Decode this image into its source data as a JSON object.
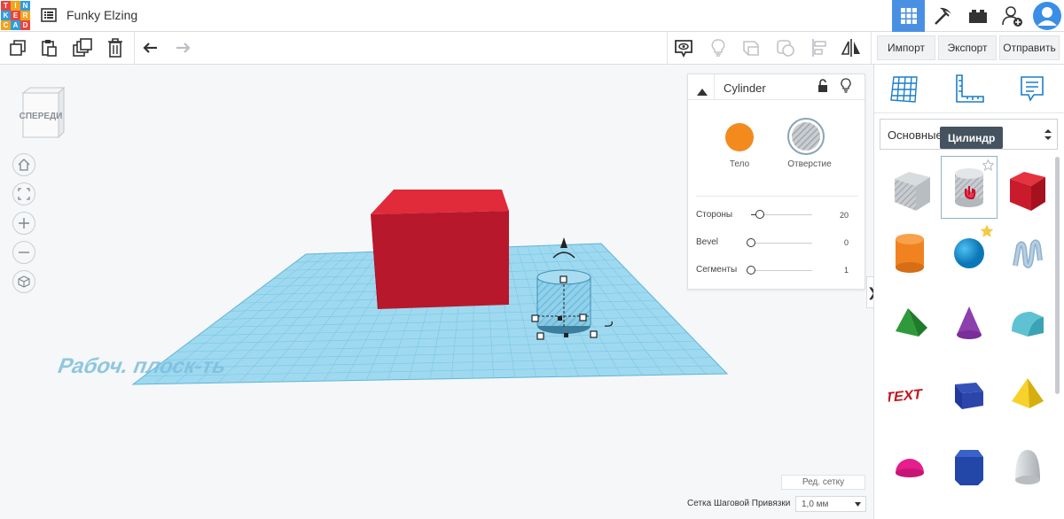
{
  "app": {
    "logo_letters": [
      "T",
      "I",
      "N",
      "K",
      "E",
      "R",
      "C",
      "A",
      "D"
    ],
    "logo_colors": [
      "#e8453c",
      "#f4a21c",
      "#2f9de0",
      "#2f9de0",
      "#e8453c",
      "#f4a21c",
      "#f4a21c",
      "#2f9de0",
      "#e8453c"
    ],
    "project_title": "Funky Elzing"
  },
  "header": {
    "right_icons": [
      "grid-view-icon",
      "pickaxe-icon",
      "bricks-icon",
      "add-user-icon",
      "avatar"
    ]
  },
  "toolbar": {
    "edit_icons": [
      "copy-icon",
      "paste-icon",
      "duplicate-icon",
      "delete-icon",
      "undo-icon",
      "redo-icon"
    ],
    "view_icons": [
      "show-notes-icon",
      "light-bulb-icon",
      "group-icon",
      "hole-icon",
      "align-icon",
      "mirror-icon"
    ],
    "import_label": "Импорт",
    "export_label": "Экспорт",
    "send_label": "Отправить"
  },
  "viewport": {
    "viewcube_label": "СПЕРЕДИ",
    "workplane_label": "Рабоч. плоск-ть"
  },
  "inspector": {
    "title": "Cylinder",
    "solid_label": "Тело",
    "hole_label": "Отверстие",
    "solid_color": "#f28a1e",
    "props": [
      {
        "label": "Стороны",
        "value": "20"
      },
      {
        "label": "Bevel",
        "value": "0"
      },
      {
        "label": "Сегменты",
        "value": "1"
      }
    ]
  },
  "sidebar": {
    "library": "Основные",
    "tooltip": "Цилиндр"
  },
  "footer": {
    "edit_grid_label": "Ред. сетку",
    "snap_label": "Сетка Шаговой Привязки",
    "snap_value": "1,0 мм"
  }
}
